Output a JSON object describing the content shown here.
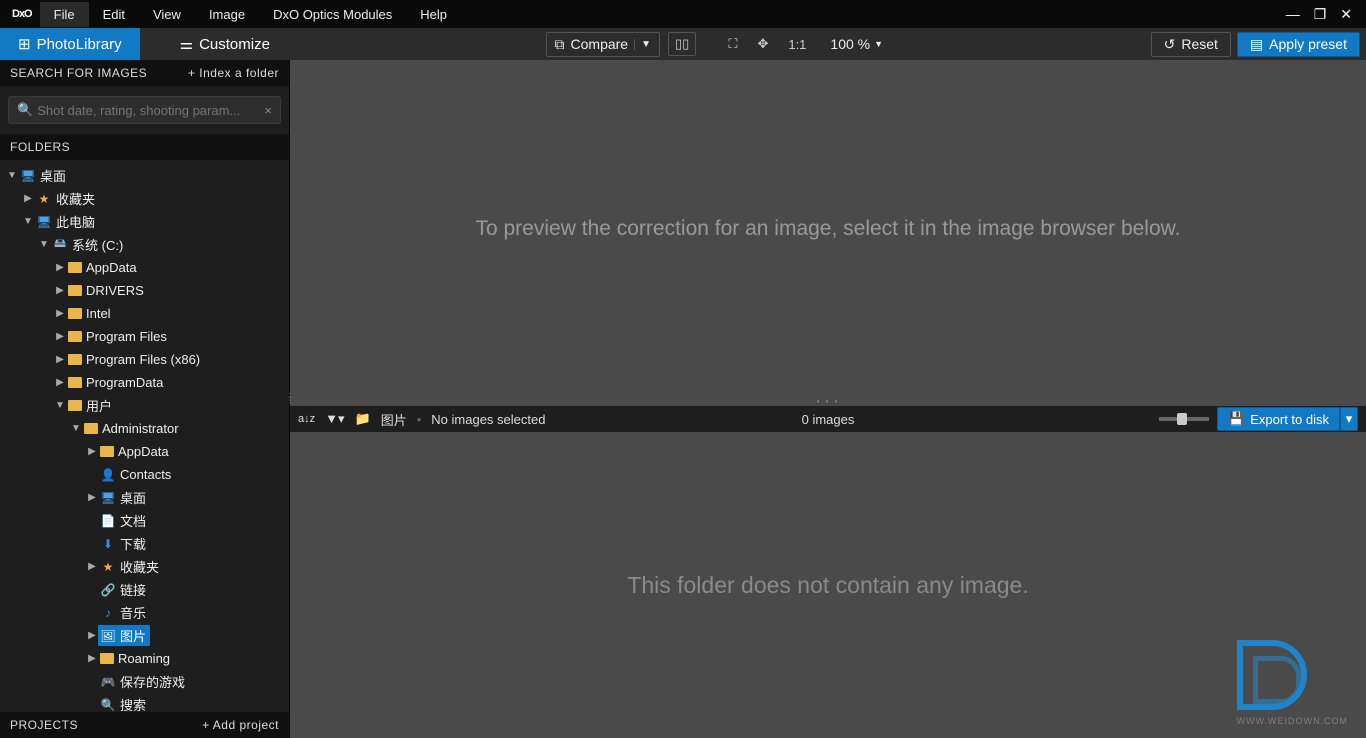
{
  "logo": "DxO",
  "menu": [
    "File",
    "Edit",
    "View",
    "Image",
    "DxO Optics Modules",
    "Help"
  ],
  "menu_active_index": 0,
  "tabs": {
    "photolibrary": "PhotoLibrary",
    "customize": "Customize"
  },
  "toolbar": {
    "compare": "Compare",
    "ratio": "1:1",
    "zoom": "100 %",
    "reset": "Reset",
    "apply_preset": "Apply preset"
  },
  "sidebar": {
    "search_hdr": "SEARCH FOR IMAGES",
    "index_link": "+ Index a folder",
    "search_placeholder": "Shot date, rating, shooting param...",
    "folders_hdr": "FOLDERS",
    "projects_hdr": "PROJECTS",
    "add_project": "+ Add project"
  },
  "tree": {
    "desktop": "桌面",
    "favorites": "收藏夹",
    "this_pc": "此电脑",
    "system_c": "系统 (C:)",
    "appdata": "AppData",
    "drivers": "DRIVERS",
    "intel": "Intel",
    "program_files": "Program Files",
    "program_files_x86": "Program Files (x86)",
    "programdata": "ProgramData",
    "users": "用户",
    "administrator": "Administrator",
    "admin_appdata": "AppData",
    "contacts": "Contacts",
    "admin_desktop": "桌面",
    "documents": "文档",
    "downloads": "下载",
    "admin_favorites": "收藏夹",
    "links": "链接",
    "music": "音乐",
    "pictures": "图片",
    "roaming": "Roaming",
    "saved_games": "保存的游戏",
    "searches": "搜索"
  },
  "preview_msg": "To preview the correction for an image, select it in the image browser below.",
  "browser": {
    "path": "图片",
    "selection": "No images selected",
    "count": "0 images",
    "export": "Export to disk",
    "empty_msg": "This folder does not contain any image."
  },
  "watermark": "WWW.WEIDOWN.COM"
}
